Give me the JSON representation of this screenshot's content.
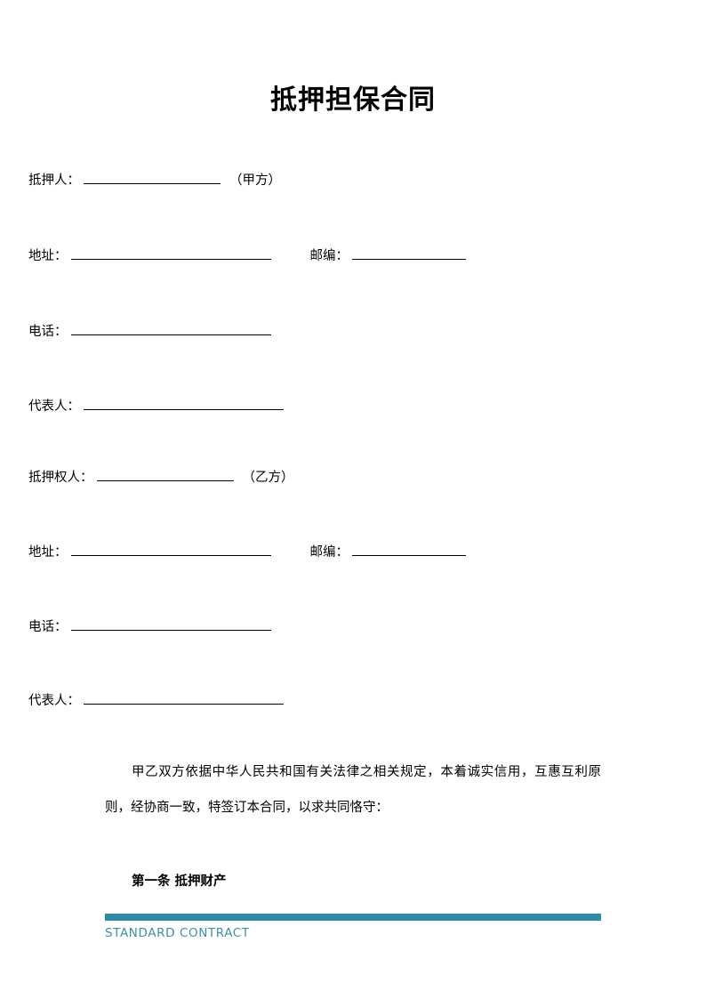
{
  "document": {
    "title": "抵押担保合同",
    "fields": [
      {
        "name": "mortgagor",
        "label": "抵押人：",
        "value": "",
        "suffix": "（甲方）",
        "blank_style": "sm"
      },
      {
        "name": "mortgagor-address",
        "label": "地址：",
        "value": "",
        "suffix": "",
        "blank_style": "md",
        "second_label": "邮编：",
        "second_value": ""
      },
      {
        "name": "mortgagor-phone",
        "label": "电话：",
        "value": "",
        "suffix": "",
        "blank_style": "md"
      },
      {
        "name": "mortgagor-representative",
        "label": "代表人：",
        "value": "",
        "suffix": "",
        "blank_style": "md"
      },
      {
        "name": "mortgagee",
        "label": "抵押权人：",
        "value": "",
        "suffix": "（乙方）",
        "blank_style": "sm"
      },
      {
        "name": "mortgagee-address",
        "label": "地址：",
        "value": "",
        "suffix": "",
        "blank_style": "md",
        "second_label": "邮编：",
        "second_value": ""
      },
      {
        "name": "mortgagee-phone",
        "label": "电话：",
        "value": "",
        "suffix": "",
        "blank_style": "md"
      },
      {
        "name": "mortgagee-representative",
        "label": "代表人：",
        "value": "",
        "suffix": "",
        "blank_style": "md"
      }
    ],
    "preamble": "甲乙双方依据中华人民共和国有关法律之相关规定，本着诚实信用，互惠互利原则，经协商一致，特签订本合同，以求共同恪守：",
    "clause_heading": "第一条 抵押财产"
  },
  "footer": {
    "label": "STANDARD CONTRACT",
    "bar_color": "#2e8ba6",
    "text_color": "#3d8faa"
  }
}
